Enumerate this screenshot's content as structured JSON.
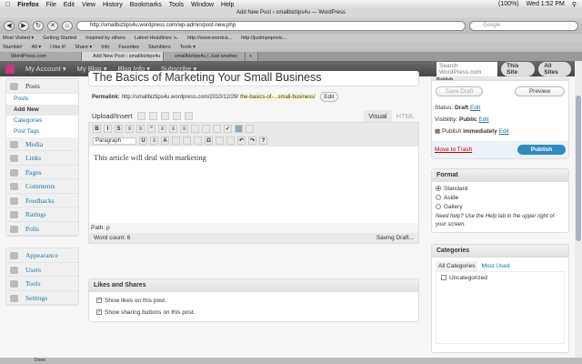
{
  "os_menu": {
    "app": "Firefox",
    "items": [
      "File",
      "Edit",
      "View",
      "History",
      "Bookmarks",
      "Tools",
      "Window",
      "Help"
    ],
    "battery": "(100%)",
    "clock": "Wed 1:52 PM"
  },
  "window_title": "Add New Post ‹ smallbiztips4u — WordPress",
  "url": "http://smallbiztips4u.wordpress.com/wp-admin/post-new.php",
  "search_placeholder": "Google",
  "bookmarks": [
    "Most Visited ▾",
    "Getting Started",
    "Inspired by others",
    "Latest Headlines ⋋",
    "http://www.wordca...",
    "http://justinpopovic..."
  ],
  "stumble": [
    "Stumble!",
    "All ▾",
    "I like it!",
    "Share ▾",
    "Info",
    "Favorites",
    "Stumblers",
    "Tools ▾"
  ],
  "tabs": [
    "WordPress.com",
    "Add New Post ‹ smallbiztips4u ...",
    "smallbiztips4u | Just another W..."
  ],
  "adminbar": {
    "items": [
      "My Account ▾",
      "My Blog ▾",
      "Blog Info ▾",
      "Subscribe ▾"
    ],
    "search_placeholder": "Search WordPress.com",
    "this_site": "This Site",
    "all_sites": "All Sites"
  },
  "sidebar": {
    "posts": "Posts",
    "sub": [
      "Posts",
      "Add New",
      "Categories",
      "Post Tags"
    ],
    "group1": [
      "Media",
      "Links",
      "Pages",
      "Comments",
      "Feedbacks",
      "Ratings",
      "Polls"
    ],
    "group2": [
      "Appearance",
      "Users",
      "Tools",
      "Settings"
    ]
  },
  "post": {
    "title": "The Basics of Marketing Your Small Business",
    "permalink_label": "Permalink:",
    "permalink_base": "http://smallbiztips4u.wordpress.com/2010/12/29/",
    "permalink_slug": "the-basics-of-...small-business/",
    "edit": "Edit",
    "upload_insert": "Upload/Insert",
    "visual": "Visual",
    "html": "HTML",
    "format_select": "Paragraph",
    "content": "This article will deal with marketing",
    "path": "Path: p",
    "word_count": "Word count: 6",
    "saving": "Saving Draft..."
  },
  "likes": {
    "title": "Likes and Shares",
    "opt1": "Show likes on this post.",
    "opt2": "Show sharing buttons on this post."
  },
  "publish": {
    "title": "Publish",
    "save_draft": "Save Draft",
    "preview": "Preview",
    "status_label": "Status:",
    "status": "Draft",
    "visibility_label": "Visibility:",
    "visibility": "Public",
    "publish_label": "Publish",
    "publish_when": "immediately",
    "edit": "Edit",
    "trash": "Move to Trash",
    "publish_btn": "Publish"
  },
  "format": {
    "title": "Format",
    "options": [
      "Standard",
      "Aside",
      "Gallery"
    ],
    "help": "Need help? Use the Help tab in the upper right of your screen."
  },
  "categories": {
    "title": "Categories",
    "tab_all": "All Categories",
    "tab_used": "Most Used",
    "item": "Uncategorized"
  },
  "statusbar": "Done"
}
